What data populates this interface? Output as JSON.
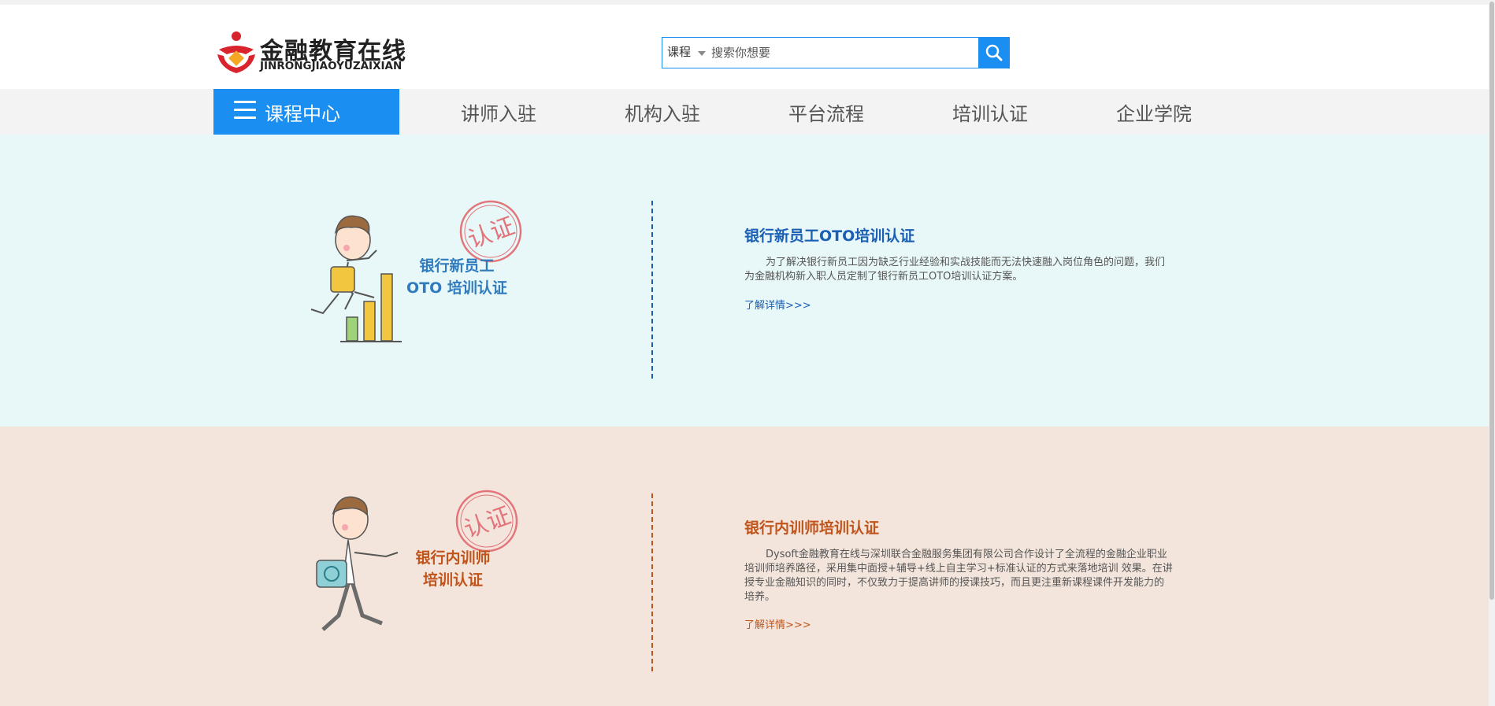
{
  "header": {
    "logo_cn": "金融教育在线",
    "logo_en": "JINRONGJIAOYUZAIXIAN",
    "search": {
      "category": "课程",
      "placeholder": "搜索你想要"
    }
  },
  "nav": {
    "course_center": "课程中心",
    "items": [
      "讲师入驻",
      "机构入驻",
      "平台流程",
      "培训认证",
      "企业学院"
    ]
  },
  "sections": [
    {
      "stamp": "认证",
      "illus_line1": "银行新员工",
      "illus_line2": "OTO 培训认证",
      "title": "银行新员工OTO培训认证",
      "description": "为了解决银行新员工因为缺乏行业经验和实战技能而无法快速融入岗位角色的问题，我们为金融机构新入职人员定制了银行新员工OTO培训认证方案。",
      "link": "了解详情>>>",
      "accent": "#1a5fb4"
    },
    {
      "stamp": "认证",
      "illus_line1": "银行内训师",
      "illus_line2": "培训认证",
      "title": "银行内训师培训认证",
      "description": "Dysoft金融教育在线与深圳联合金融服务集团有限公司合作设计了全流程的金融企业职业培训师培养路径，采用集中面授+辅导+线上自主学习+标准认证的方式来落地培训 效果。在讲授专业金融知识的同时，不仅致力于提高讲师的授课技巧，而且更注重新课程课件开发能力的培养。",
      "link": "了解详情>>>",
      "accent": "#c0541b"
    }
  ],
  "colors": {
    "brand_blue": "#1b8ef1",
    "section1_bg": "#e8f7f7",
    "section2_bg": "#f3e5dc"
  }
}
